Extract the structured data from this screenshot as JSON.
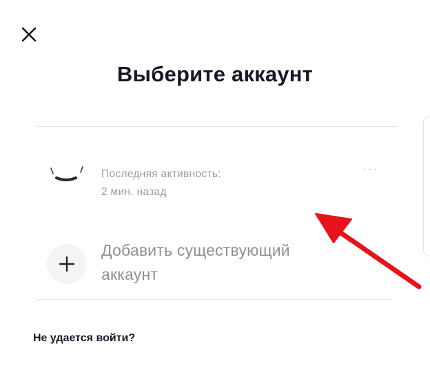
{
  "header": {
    "title": "Выберите аккаунт"
  },
  "account": {
    "activity_line1": "Последняя активность:",
    "activity_line2": "2 мин. назад",
    "more_label": "···"
  },
  "add_account": {
    "label": "Добавить существующий аккаунт"
  },
  "footer": {
    "cant_login": "Не удается войти?"
  },
  "icons": {
    "close": "close-icon",
    "more": "more-dots-icon",
    "add": "plus-icon",
    "annotation": "red-arrow"
  },
  "colors": {
    "title": "#161823",
    "secondary_text": "#9a9ba0",
    "divider": "#e6e6e8",
    "annotation_arrow": "#e8121b"
  }
}
